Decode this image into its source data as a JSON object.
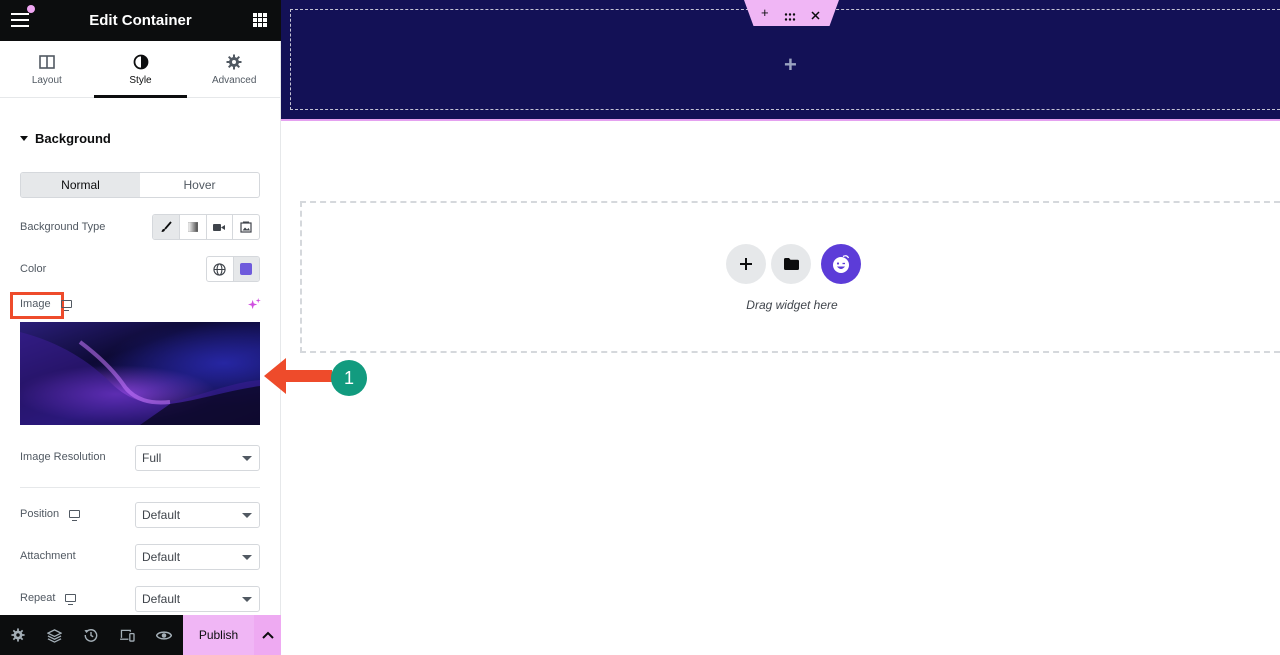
{
  "panel": {
    "title": "Edit Container",
    "tabs": [
      {
        "label": "Layout",
        "icon": "layout-icon",
        "active": false
      },
      {
        "label": "Style",
        "icon": "contrast-icon",
        "active": true
      },
      {
        "label": "Advanced",
        "icon": "gear-icon",
        "active": false
      }
    ],
    "section": "Background",
    "state_tabs": {
      "normal": "Normal",
      "hover": "Hover",
      "active": "Normal"
    },
    "background_type": {
      "label": "Background Type",
      "options": [
        "classic-brush-icon",
        "gradient-icon",
        "video-icon",
        "slideshow-icon"
      ],
      "selected": "classic"
    },
    "color": {
      "label": "Color",
      "value": "#6f5bdc"
    },
    "image": {
      "label": "Image"
    },
    "image_resolution": {
      "label": "Image Resolution",
      "value": "Full"
    },
    "position": {
      "label": "Position",
      "value": "Default"
    },
    "attachment": {
      "label": "Attachment",
      "value": "Default"
    },
    "repeat": {
      "label": "Repeat",
      "value": "Default"
    }
  },
  "footer": {
    "publish_label": "Publish",
    "buttons": [
      "settings-icon",
      "layers-icon",
      "history-icon",
      "responsive-icon",
      "preview-icon"
    ]
  },
  "canvas": {
    "drop_text": "Drag widget here",
    "hero_color": "#131156",
    "accent": "#f0b6f5",
    "brand_purple": "#5c3cd8"
  },
  "annotation": {
    "step": "1",
    "highlight_color": "#ee4b2b",
    "badge_color": "#129b7f"
  }
}
